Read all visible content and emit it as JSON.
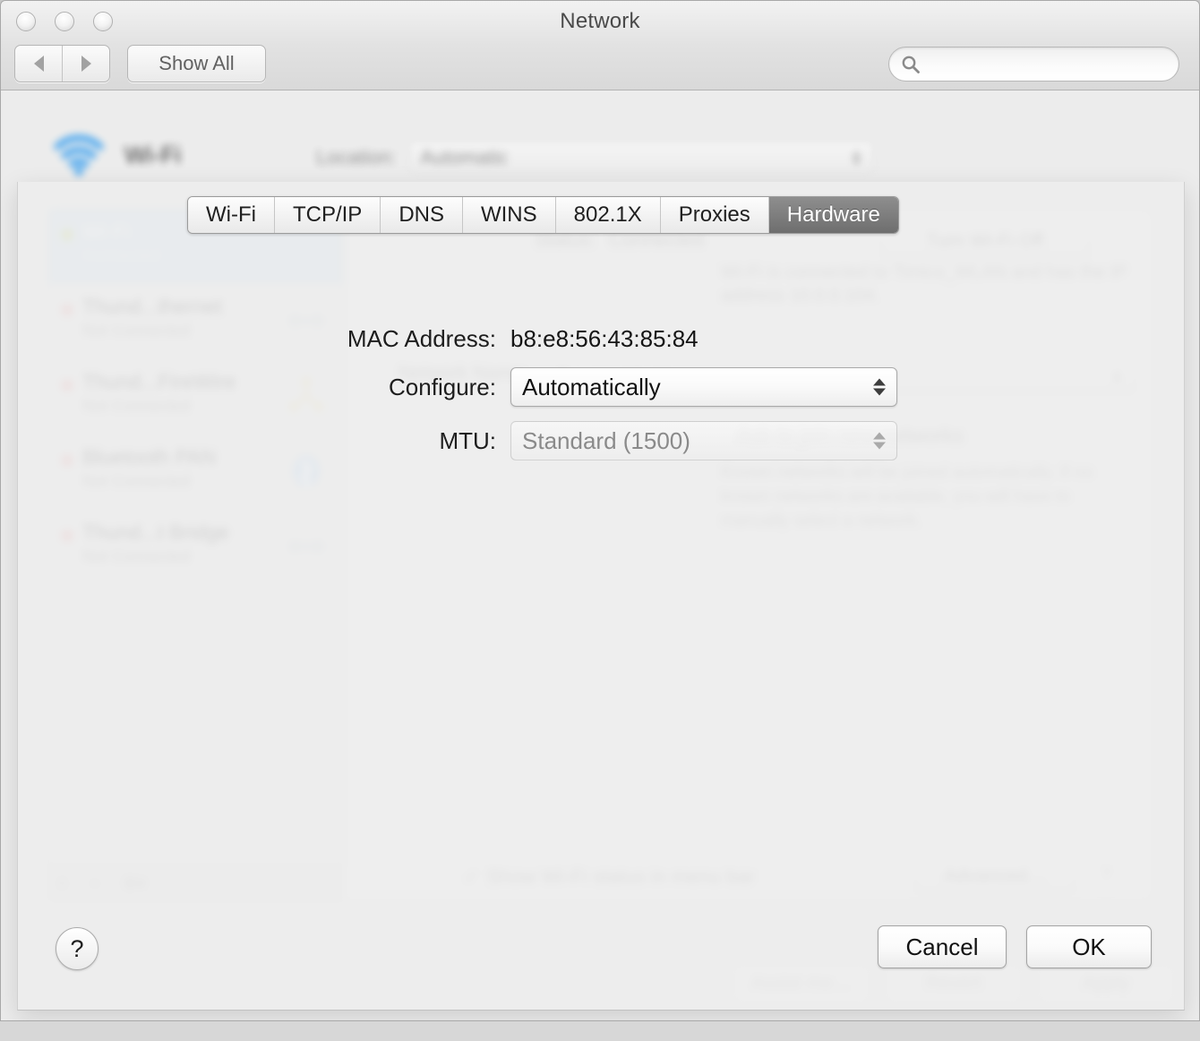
{
  "window": {
    "title": "Network",
    "show_all_label": "Show All",
    "search_placeholder": "",
    "search_value": "",
    "back_icon": "back-arrow-icon",
    "forward_icon": "forward-arrow-icon",
    "search_icon": "search-icon"
  },
  "background": {
    "service_name": "Wi-Fi",
    "wifi_icon": "wifi-icon",
    "location_label": "Location:",
    "location_value": "Automatic",
    "sidebar": {
      "items": [
        {
          "name": "Wi-Fi",
          "status": "Connected",
          "dot": "green",
          "icon": "wifi-icon",
          "selected": true
        },
        {
          "name": "Thund...thernet",
          "status": "Not Connected",
          "dot": "red",
          "icon": "ethernet-icon",
          "selected": false
        },
        {
          "name": "Thund...FireWire",
          "status": "Not Connected",
          "dot": "red",
          "icon": "firewire-icon",
          "selected": false
        },
        {
          "name": "Bluetooth PAN",
          "status": "Not Connected",
          "dot": "red",
          "icon": "bluetooth-icon",
          "selected": false
        },
        {
          "name": "Thund...t Bridge",
          "status": "Not Connected",
          "dot": "red",
          "icon": "bridge-icon",
          "selected": false
        }
      ],
      "add_label": "+",
      "remove_label": "−",
      "action_label": "⚙▾"
    },
    "status_label": "Status:",
    "status_value": "Connected",
    "turn_off_label": "Turn Wi-Fi Off",
    "status_description": "Wi-Fi is connected to Timico_WLAN and has the IP address 10.0.0.104.",
    "network_name_label": "Network Name:",
    "network_name_value": "Timico_WLAN",
    "ask_to_join_label": "Ask to join new networks",
    "ask_to_join_description": "Known networks will be joined automatically. If no known networks are available, you will have to manually select a network.",
    "show_status_checkmark": "✓",
    "show_status_label": "Show Wi-Fi status in menu bar",
    "advanced_label": "Advanced…",
    "pane_help_label": "?",
    "assist_label": "Assist me…",
    "revert_label": "Revert",
    "apply_label": "Apply"
  },
  "sheet": {
    "tabs": [
      {
        "label": "Wi-Fi",
        "active": false
      },
      {
        "label": "TCP/IP",
        "active": false
      },
      {
        "label": "DNS",
        "active": false
      },
      {
        "label": "WINS",
        "active": false
      },
      {
        "label": "802.1X",
        "active": false
      },
      {
        "label": "Proxies",
        "active": false
      },
      {
        "label": "Hardware",
        "active": true
      }
    ],
    "fields": {
      "mac_label": "MAC Address:",
      "mac_value": "b8:e8:56:43:85:84",
      "configure_label": "Configure:",
      "configure_value": "Automatically",
      "mtu_label": "MTU:",
      "mtu_value": "Standard  (1500)"
    },
    "help_label": "?",
    "cancel_label": "Cancel",
    "ok_label": "OK"
  },
  "colors": {
    "selection_blue": "#cedfee",
    "active_tab": "#7e7e7e",
    "wifi_blue": "#2f9bee"
  }
}
